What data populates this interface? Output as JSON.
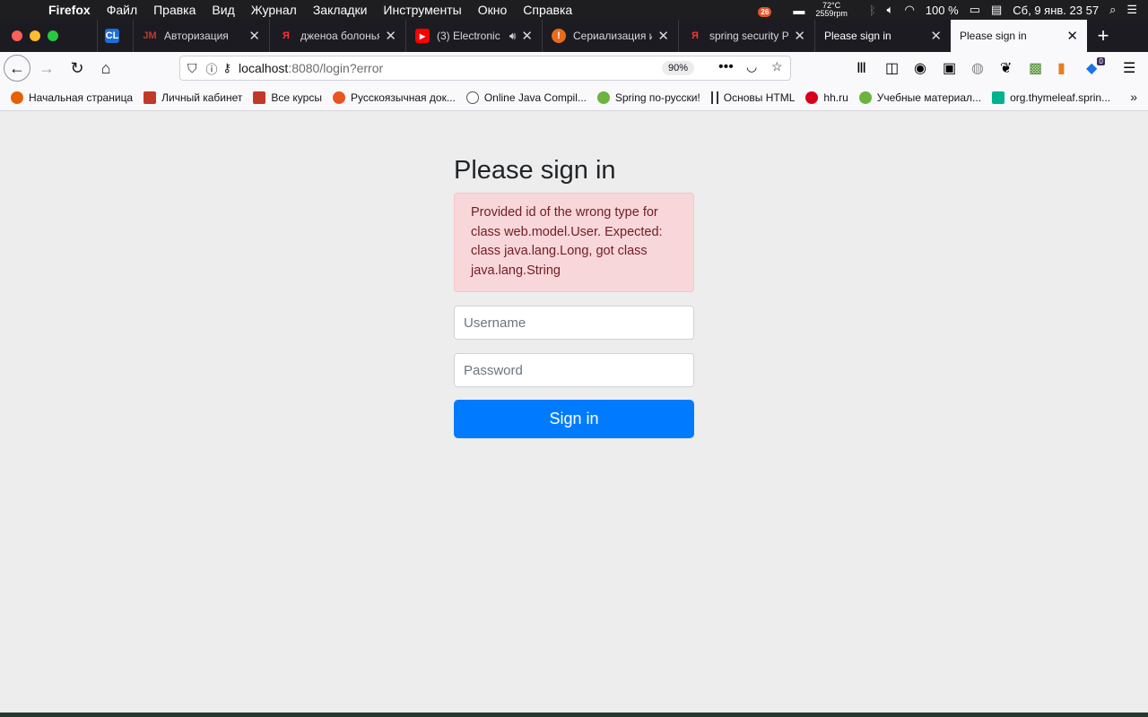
{
  "menubar": {
    "app": "Firefox",
    "items": [
      "Файл",
      "Правка",
      "Вид",
      "Журнал",
      "Закладки",
      "Инструменты",
      "Окно",
      "Справка"
    ],
    "status": {
      "notif_count": "26",
      "temp": "72°C",
      "rpm": "2559rpm",
      "battery": "100 %",
      "datetime": "Сб, 9 янв.  23 57"
    }
  },
  "tabs": [
    {
      "title": "",
      "favicon": "CL"
    },
    {
      "title": "Авторизация",
      "favicon": "JM"
    },
    {
      "title": "дженоа болонья",
      "favicon": "Я"
    },
    {
      "title": "(3) Electronic",
      "favicon": "▶"
    },
    {
      "title": "Сериализация и",
      "favicon": "!"
    },
    {
      "title": "spring security P",
      "favicon": "Я"
    },
    {
      "title": "Please sign in",
      "favicon": ""
    },
    {
      "title": "Please sign in",
      "favicon": "",
      "active": true
    }
  ],
  "navbar": {
    "url_host": "localhost",
    "url_rest": ":8080/login?error",
    "zoom": "90%",
    "extension_badge": "0"
  },
  "bookmarks": [
    {
      "label": "Начальная страница",
      "color": "#e66000"
    },
    {
      "label": "Личный кабинет",
      "color": "#c0392b"
    },
    {
      "label": "Все курсы",
      "color": "#c0392b"
    },
    {
      "label": "Русскоязычная док...",
      "color": "#e95420"
    },
    {
      "label": "Online Java Compil...",
      "color": "#555555"
    },
    {
      "label": "Spring по-русски!",
      "color": "#6db33f"
    },
    {
      "label": "Основы HTML",
      "color": "#333333"
    },
    {
      "label": "hh.ru",
      "color": "#d6001c"
    },
    {
      "label": "Учебные материал...",
      "color": "#6db33f"
    },
    {
      "label": "org.thymeleaf.sprin...",
      "color": "#00b38f"
    }
  ],
  "signin": {
    "heading": "Please sign in",
    "error": "Provided id of the wrong type for class web.model.User. Expected: class java.lang.Long, got class java.lang.String",
    "username_placeholder": "Username",
    "password_placeholder": "Password",
    "button": "Sign in"
  },
  "colors": {
    "primary": "#007bff",
    "alert_bg": "#f8d7da",
    "alert_text": "#721c24"
  }
}
